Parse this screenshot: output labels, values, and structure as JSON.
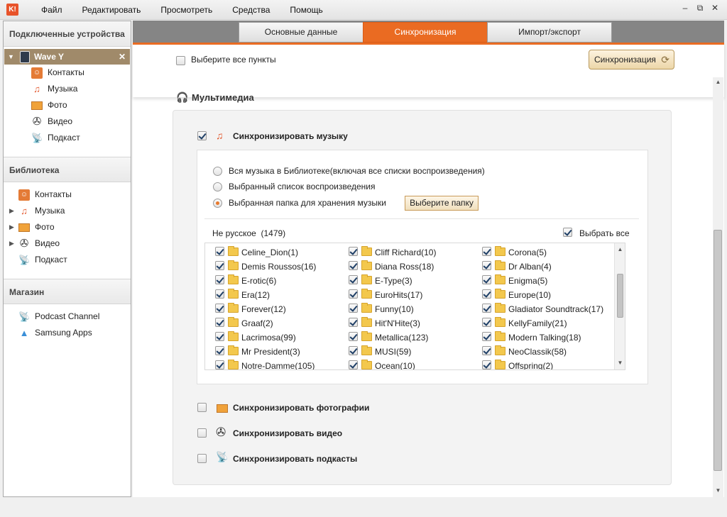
{
  "app": {
    "logo": "K!"
  },
  "menu": [
    "Файл",
    "Редактировать",
    "Просмотреть",
    "Средства",
    "Помощь"
  ],
  "window_controls": [
    "‒",
    "⧉",
    "✕"
  ],
  "sidebar": {
    "devices_title": "Подключенные устройства",
    "device": {
      "name": "Wave Y",
      "close": "✕"
    },
    "device_items": [
      "Контакты",
      "Музыка",
      "Фото",
      "Видео",
      "Подкаст"
    ],
    "library_title": "Библиотека",
    "library_items": [
      "Контакты",
      "Музыка",
      "Фото",
      "Видео",
      "Подкаст"
    ],
    "store_title": "Магазин",
    "store_items": [
      "Podcast Channel",
      "Samsung Apps"
    ]
  },
  "tabs": [
    "Основные данные",
    "Синхронизация",
    "Импорт/экспорт"
  ],
  "toolbar": {
    "select_all": "Выберите все пункты",
    "sync_button": "Синхронизация"
  },
  "multimedia": {
    "title": "Мультимедиа",
    "sync_music": "Синхронизировать музыку",
    "options": [
      "Вся музыка в Библиотеке(включая все списки воспроизведения)",
      "Выбранный список воспроизведения",
      "Выбранная папка для хранения музыки"
    ],
    "choose_folder": "Выберите папку",
    "folder_header": "Не русское  (1479)",
    "select_all": "Выбрать все",
    "folders": [
      [
        "Celine_Dion(1)",
        "Cliff Richard(10)",
        "Corona(5)"
      ],
      [
        "Demis Roussos(16)",
        "Diana Ross(18)",
        "Dr Alban(4)"
      ],
      [
        "E-rotic(6)",
        "E-Type(3)",
        "Enigma(5)"
      ],
      [
        "Era(12)",
        "EuroHits(17)",
        "Europe(10)"
      ],
      [
        "Forever(12)",
        "Funny(10)",
        "Gladiator Soundtrack(17)"
      ],
      [
        "Graaf(2)",
        "Hit'N'Hite(3)",
        "KellyFamily(21)"
      ],
      [
        "Lacrimosa(99)",
        "Metallica(123)",
        "Modern Talking(18)"
      ],
      [
        "Mr President(3)",
        "MUSI(59)",
        "NeoClassik(58)"
      ],
      [
        "Notre-Damme(105)",
        "Ocean(10)",
        "Offspring(2)"
      ]
    ],
    "sync_photos": "Синхронизировать фотографии",
    "sync_video": "Синхронизировать видео",
    "sync_podcasts": "Синхронизировать подкасты"
  }
}
